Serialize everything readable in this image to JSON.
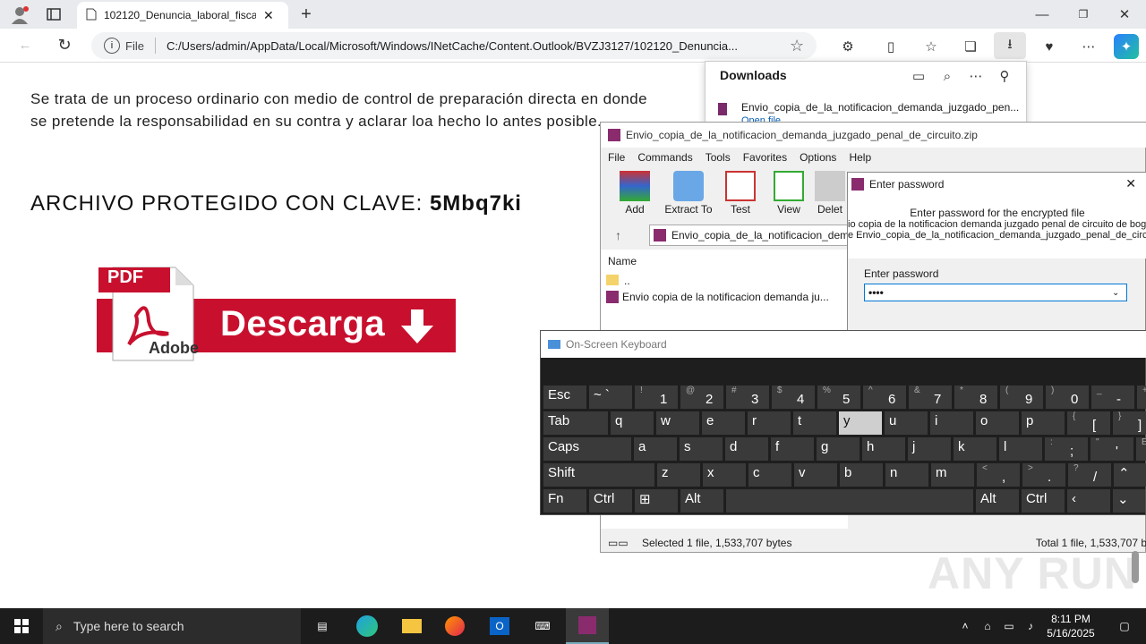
{
  "browser": {
    "tab_title": "102120_Denuncia_laboral_fiscal_",
    "address_prefix": "File",
    "address": "C:/Users/admin/AppData/Local/Microsoft/Windows/INetCache/Content.Outlook/BVZJ3127/102120_Denuncia..."
  },
  "page": {
    "paragraph": "Se trata de un proceso ordinario con medio de control de preparación directa en donde se pretende la responsabilidad en su contra y aclarar loa hecho lo antes posible.",
    "clave_label": "ARCHIVO PROTEGIDO CON CLAVE: ",
    "clave_value": "5Mbq7ki",
    "pdf_label": "PDF",
    "adobe_label": "Adobe",
    "download_label": "Descarga"
  },
  "downloads": {
    "title": "Downloads",
    "item": "Envio_copia_de_la_notificacion_demanda_juzgado_pen...",
    "sub": "Open file"
  },
  "winrar": {
    "title": "Envio_copia_de_la_notificacion_demanda_juzgado_penal_de_circuito.zip",
    "menu": [
      "File",
      "Commands",
      "Tools",
      "Favorites",
      "Options",
      "Help"
    ],
    "tools": [
      "Add",
      "Extract To",
      "Test",
      "View",
      "Delet"
    ],
    "path": "Envio_copia_de_la_notificacion_dema",
    "col_name": "Name",
    "files": [
      "..",
      "Envio copia de la notificacion demanda ju..."
    ],
    "status_left": "Selected 1 file, 1,533,707 bytes",
    "status_right": "Total 1 file, 1,533,707 b"
  },
  "password_dialog": {
    "title": "Enter password",
    "heading": "Enter password for the encrypted file",
    "line1": "io copia de la notificacion demanda juzgado penal de circuito de bogo",
    "line2": "e Envio_copia_de_la_notificacion_demanda_juzgado_penal_de_circu",
    "field_label": "Enter password",
    "field_value": "••••"
  },
  "osk": {
    "title": "On-Screen Keyboard",
    "row1": [
      [
        "Esc",
        ""
      ],
      [
        "~ `",
        ""
      ],
      [
        "!",
        "1"
      ],
      [
        "@",
        "2"
      ],
      [
        "#",
        "3"
      ],
      [
        "$",
        "4"
      ],
      [
        "%",
        "5"
      ],
      [
        "^",
        "6"
      ],
      [
        "&",
        "7"
      ],
      [
        "*",
        "8"
      ],
      [
        "(",
        "9"
      ],
      [
        ")",
        "0"
      ],
      [
        "_",
        "-"
      ],
      [
        "+",
        ""
      ]
    ],
    "row2": [
      "Tab",
      "q",
      "w",
      "e",
      "r",
      "t",
      "y",
      "u",
      "i",
      "o",
      "p"
    ],
    "row2_extra": [
      [
        "{",
        "["
      ],
      [
        "}",
        "]"
      ]
    ],
    "row3": [
      "Caps",
      "a",
      "s",
      "d",
      "f",
      "g",
      "h",
      "j",
      "k",
      "l"
    ],
    "row3_extra": [
      [
        ":",
        ";"
      ],
      [
        "\"",
        "'"
      ],
      [
        "E",
        ""
      ]
    ],
    "row4": [
      "Shift",
      "z",
      "x",
      "c",
      "v",
      "b",
      "n",
      "m"
    ],
    "row4_extra": [
      [
        "<",
        ","
      ],
      [
        ">",
        "."
      ],
      [
        "?",
        "/"
      ]
    ],
    "row5": [
      "Fn",
      "Ctrl",
      "",
      "Alt",
      "",
      "Alt",
      "Ctrl"
    ]
  },
  "taskbar": {
    "search_placeholder": "Type here to search",
    "time": "8:11 PM",
    "date": "5/16/2025"
  },
  "watermark": "ANY RUN"
}
